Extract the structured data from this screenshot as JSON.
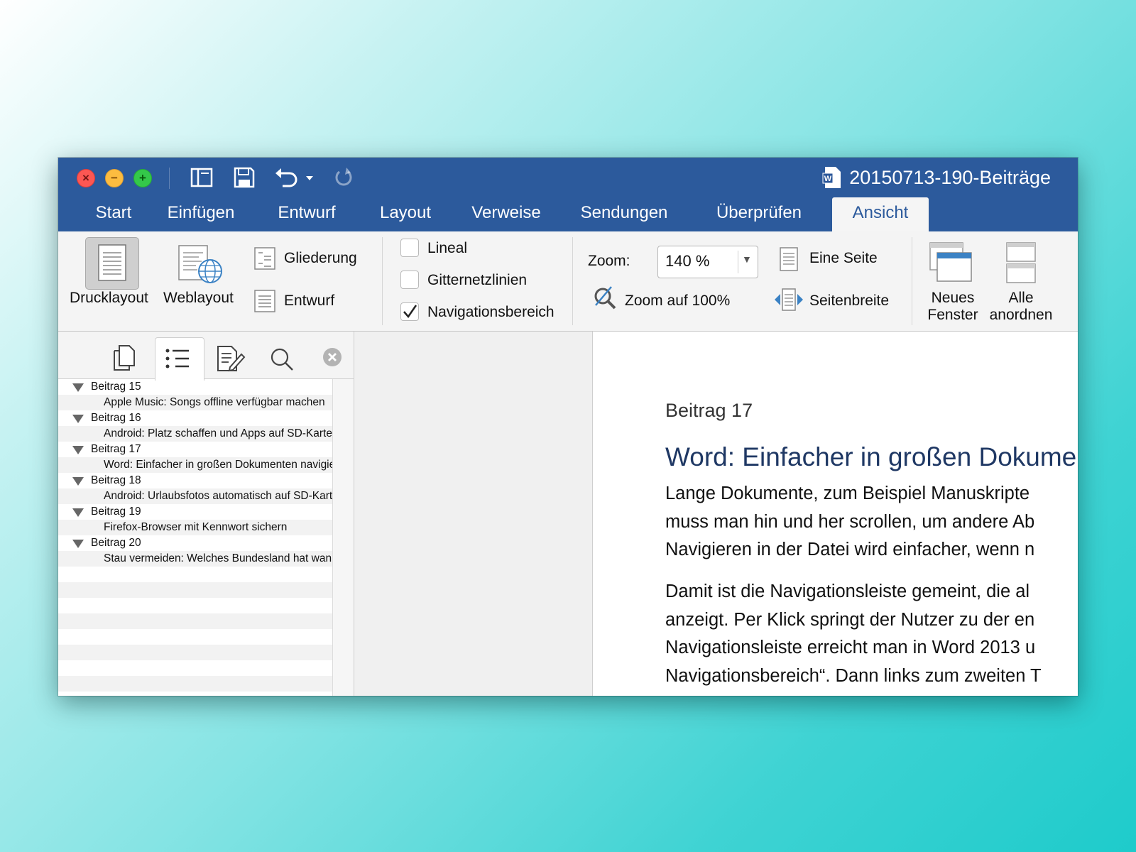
{
  "window": {
    "title": "20150713-190-Beiträge"
  },
  "tabs": [
    "Start",
    "Einfügen",
    "Entwurf",
    "Layout",
    "Verweise",
    "Sendungen",
    "Überprüfen",
    "Ansicht"
  ],
  "active_tab": "Ansicht",
  "ribbon": {
    "views": {
      "print_layout": "Drucklayout",
      "web_layout": "Weblayout",
      "outline": "Gliederung",
      "draft": "Entwurf"
    },
    "show": {
      "ruler": "Lineal",
      "gridlines": "Gitternetzlinien",
      "navigation_pane": "Navigationsbereich",
      "ruler_checked": false,
      "gridlines_checked": false,
      "navigation_pane_checked": true
    },
    "zoom": {
      "label": "Zoom:",
      "value": "140 %",
      "zoom100": "Zoom auf 100%",
      "one_page": "Eine Seite",
      "page_width": "Seitenbreite"
    },
    "window": {
      "new_window_line1": "Neues",
      "new_window_line2": "Fenster",
      "arrange_all_line1": "Alle",
      "arrange_all_line2": "anordnen"
    }
  },
  "nav_pane": {
    "items": [
      {
        "heading": "Beitrag 15",
        "sub": "Apple Music: Songs offline verfügbar machen"
      },
      {
        "heading": "Beitrag 16",
        "sub": "Android: Platz schaffen und Apps auf SD-Karte"
      },
      {
        "heading": "Beitrag 17",
        "sub": "Word: Einfacher in großen Dokumenten navigie"
      },
      {
        "heading": "Beitrag 18",
        "sub": "Android: Urlaubsfotos automatisch auf SD-Kart"
      },
      {
        "heading": "Beitrag 19",
        "sub": "Firefox-Browser mit Kennwort sichern"
      },
      {
        "heading": "Beitrag 20",
        "sub": "Stau vermeiden: Welches Bundesland hat wann"
      }
    ]
  },
  "document": {
    "label": "Beitrag 17",
    "heading": "Word: Einfacher in großen Dokume",
    "para1": [
      "Lange Dokumente, zum Beispiel Manuskripte",
      "muss man hin und her scrollen, um andere Ab",
      "Navigieren in der Datei wird einfacher, wenn n"
    ],
    "para2": [
      "Damit ist die Navigationsleiste gemeint, die al",
      "anzeigt. Per Klick springt der Nutzer zu der en",
      "Navigationsleiste erreicht man in Word 2013 u",
      "Navigationsbereich“. Dann links zum zweiten T"
    ]
  },
  "colors": {
    "titlebar": "#2c5a9c",
    "ribbon": "#f4f4f4",
    "heading": "#1f3864"
  }
}
